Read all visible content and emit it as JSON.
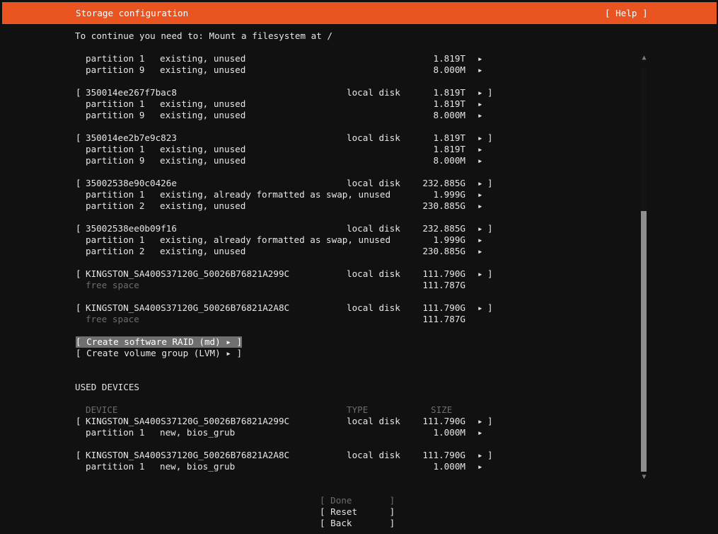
{
  "header": {
    "title": "Storage configuration",
    "help_label": "[ Help ]"
  },
  "instruction": "To continue you need to: Mount a filesystem at /",
  "available_devices": [
    {
      "name": "",
      "type": "",
      "size": "",
      "partitions": [
        {
          "label": "partition 1",
          "desc": "existing, unused",
          "size": "1.819T"
        },
        {
          "label": "partition 9",
          "desc": "existing, unused",
          "size": "8.000M"
        }
      ]
    },
    {
      "name": "350014ee267f7bac8",
      "type": "local disk",
      "size": "1.819T",
      "partitions": [
        {
          "label": "partition 1",
          "desc": "existing, unused",
          "size": "1.819T"
        },
        {
          "label": "partition 9",
          "desc": "existing, unused",
          "size": "8.000M"
        }
      ]
    },
    {
      "name": "350014ee2b7e9c823",
      "type": "local disk",
      "size": "1.819T",
      "partitions": [
        {
          "label": "partition 1",
          "desc": "existing, unused",
          "size": "1.819T"
        },
        {
          "label": "partition 9",
          "desc": "existing, unused",
          "size": "8.000M"
        }
      ]
    },
    {
      "name": "35002538e90c0426e",
      "type": "local disk",
      "size": "232.885G",
      "partitions": [
        {
          "label": "partition 1",
          "desc": "existing, already formatted as swap, unused",
          "size": "1.999G"
        },
        {
          "label": "partition 2",
          "desc": "existing, unused",
          "size": "230.885G"
        }
      ]
    },
    {
      "name": "35002538ee0b09f16",
      "type": "local disk",
      "size": "232.885G",
      "partitions": [
        {
          "label": "partition 1",
          "desc": "existing, already formatted as swap, unused",
          "size": "1.999G"
        },
        {
          "label": "partition 2",
          "desc": "existing, unused",
          "size": "230.885G"
        }
      ]
    },
    {
      "name": "KINGSTON_SA400S37120G_50026B76821A299C",
      "type": "local disk",
      "size": "111.790G",
      "free_label": "free space",
      "free_size": "111.787G"
    },
    {
      "name": "KINGSTON_SA400S37120G_50026B76821A2A8C",
      "type": "local disk",
      "size": "111.790G",
      "free_label": "free space",
      "free_size": "111.787G"
    }
  ],
  "actions": {
    "create_raid": "[ Create software RAID (md) ▸ ]",
    "create_lvm": "[ Create volume group (LVM) ▸ ]"
  },
  "used_devices": {
    "heading": "USED DEVICES",
    "col_device": "DEVICE",
    "col_type": "TYPE",
    "col_size": "SIZE",
    "items": [
      {
        "name": "KINGSTON_SA400S37120G_50026B76821A299C",
        "type": "local disk",
        "size": "111.790G",
        "partition_label": "partition 1",
        "partition_desc": "new, bios_grub",
        "partition_size": "1.000M"
      },
      {
        "name": "KINGSTON_SA400S37120G_50026B76821A2A8C",
        "type": "local disk",
        "size": "111.790G",
        "partition_label": "partition 1",
        "partition_desc": "new, bios_grub",
        "partition_size": "1.000M"
      }
    ]
  },
  "glyphs": {
    "arrow": "▸",
    "open_bracket": "[",
    "close_bracket": "]",
    "scroll_up": "▲",
    "scroll_down": "▼"
  },
  "buttons": {
    "done": "[ Done       ]",
    "reset": "[ Reset      ]",
    "back": "[ Back       ]"
  },
  "colors": {
    "header_bg": "#e95420",
    "background": "#111111",
    "highlight": "#6f6f6f"
  }
}
